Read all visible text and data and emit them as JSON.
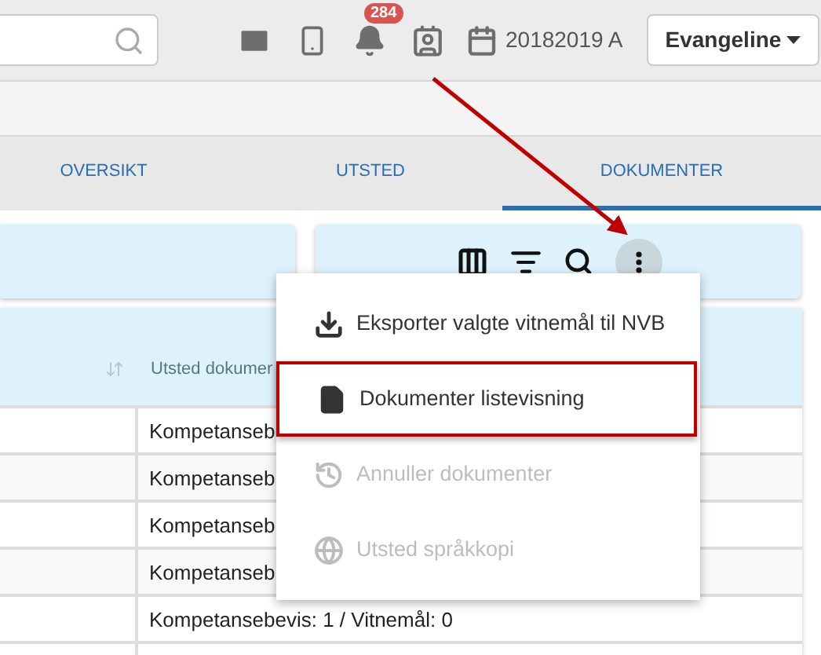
{
  "header": {
    "notifications_badge": "284",
    "school_year": "20182019 A",
    "user_button": "Evangeline"
  },
  "tabs": [
    {
      "label": "OVERSIKT",
      "selected": false
    },
    {
      "label": "UTSTED",
      "selected": false
    },
    {
      "label": "DOKUMENTER",
      "selected": true
    }
  ],
  "table": {
    "columns": [
      "Utsted dokumer"
    ],
    "rows": [
      "Kompetanseb",
      "Kompetanseb",
      "Kompetanseb",
      "Kompetanseb",
      "Kompetansebevis: 1 / Vitnemål: 0"
    ]
  },
  "menu": {
    "items": [
      {
        "label": "Eksporter valgte vitnemål til NVB",
        "kind": "download",
        "disabled": false,
        "highlighted": false
      },
      {
        "label": "Dokumenter listevisning",
        "kind": "file",
        "disabled": false,
        "highlighted": true
      },
      {
        "label": "Annuller dokumenter",
        "kind": "history",
        "disabled": true,
        "highlighted": false
      },
      {
        "label": "Utsted språkkopi",
        "kind": "globe",
        "disabled": true,
        "highlighted": false
      }
    ]
  }
}
